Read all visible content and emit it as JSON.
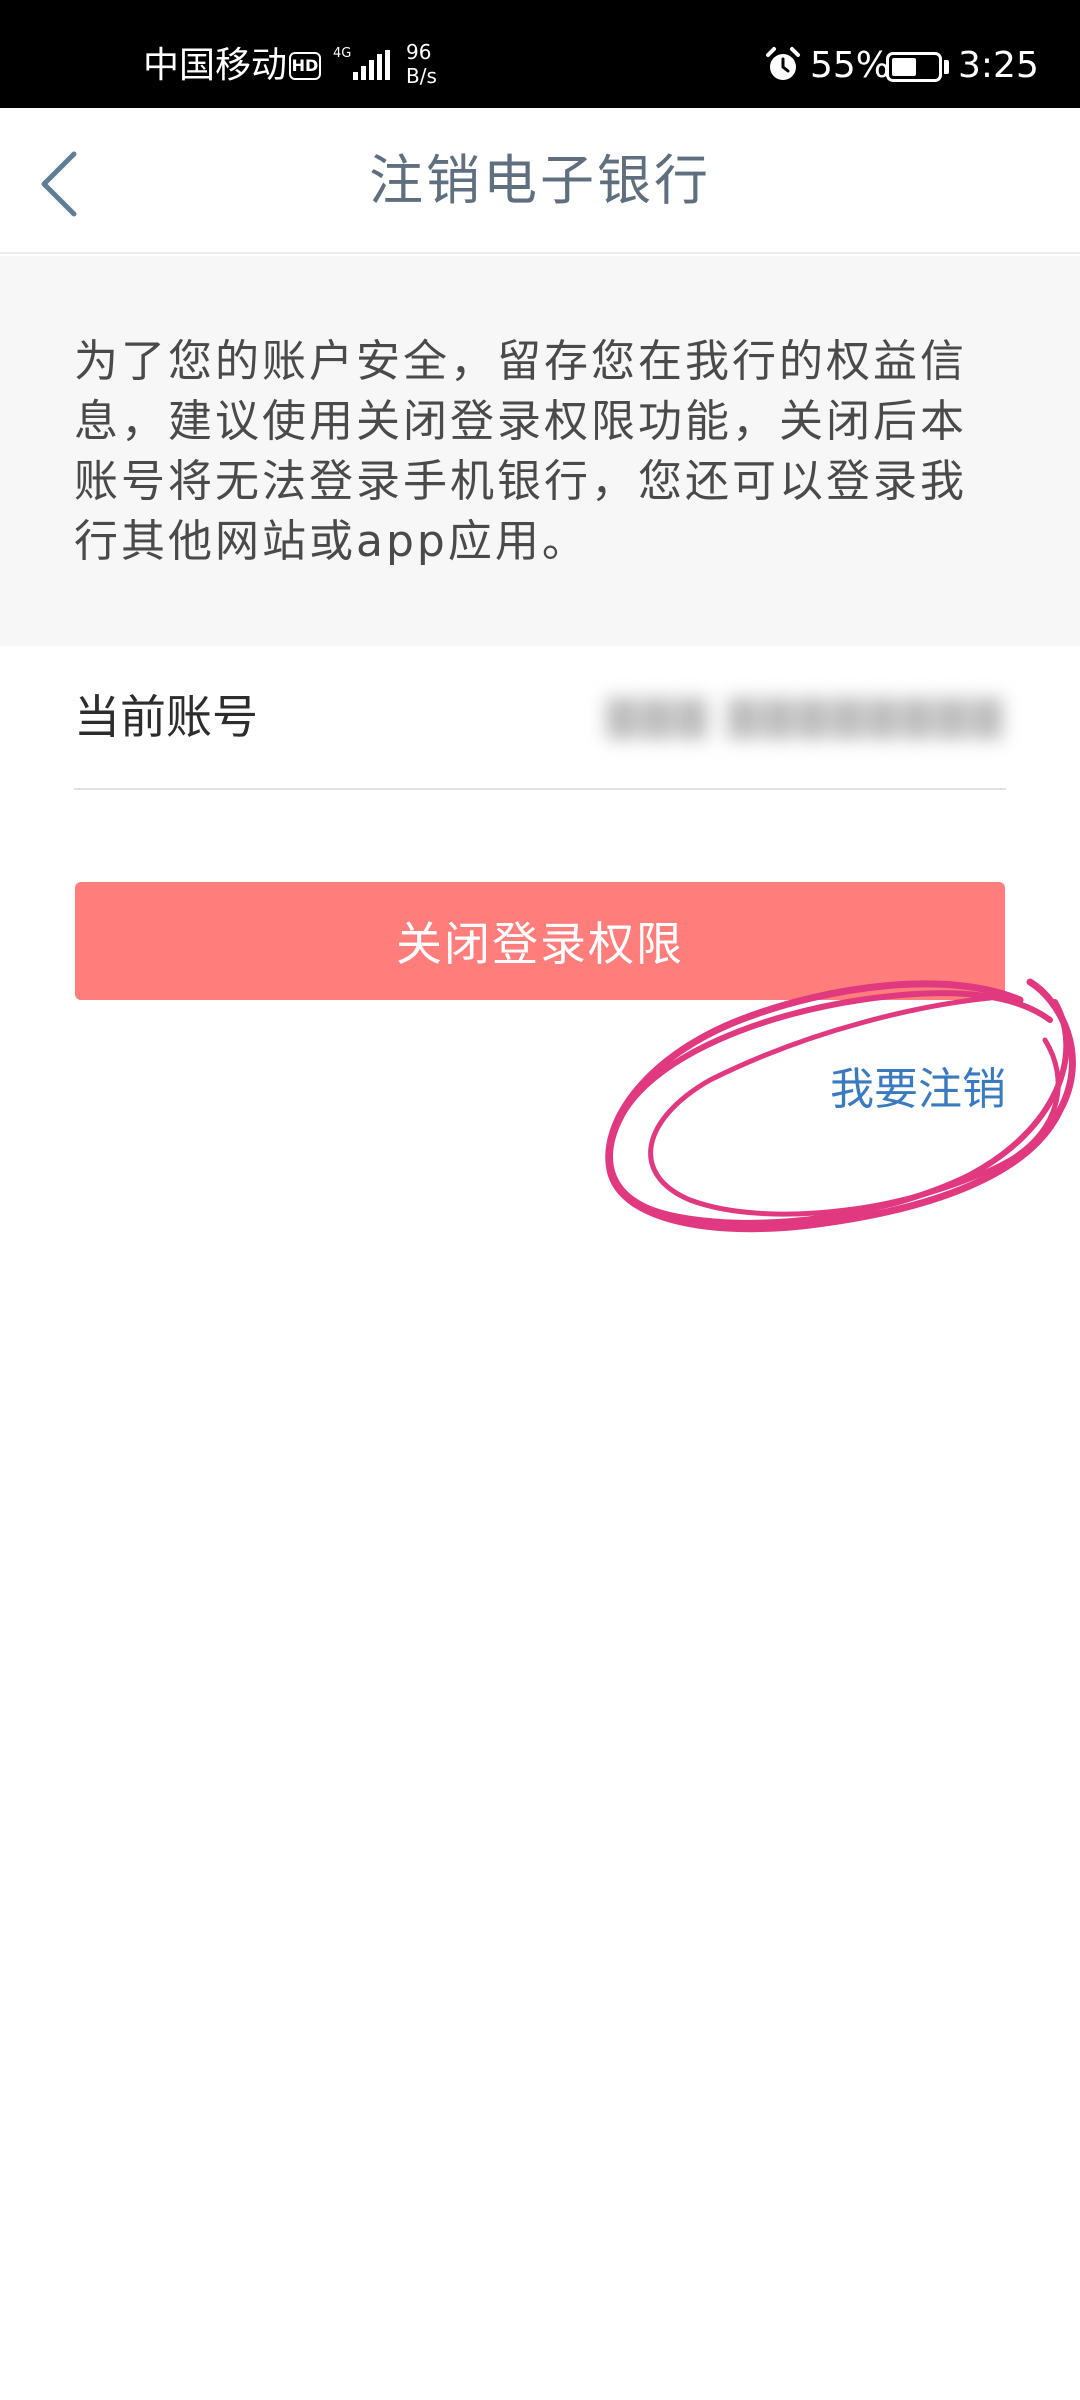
{
  "status_bar": {
    "carrier": "中国移动",
    "hd_badge": "HD",
    "network_type": "4G",
    "net_speed_value": "96",
    "net_speed_unit": "B/s",
    "battery_percent_text": "55%",
    "battery_level": 0.55,
    "time": "3:25",
    "alarm_icon": "alarm-clock-icon",
    "battery_icon": "battery-icon",
    "signal_icon": "cellular-signal-icon"
  },
  "header": {
    "title": "注销电子银行",
    "back_icon": "chevron-left-icon"
  },
  "notice": {
    "text": "为了您的账户安全，留存您在我行的权益信息，建议使用关闭登录权限功能，关闭后本账号将无法登录手机银行，您还可以登录我行其他网站或app应用。"
  },
  "account": {
    "label": "当前账号"
  },
  "actions": {
    "close_login_label": "关闭登录权限",
    "cancel_label": "我要注销"
  },
  "colors": {
    "status_bar_bg": "#000000",
    "title_color": "#5f6f7f",
    "notice_bg": "#f7f7f7",
    "primary_button": "#ff7d7b",
    "link": "#3a7bbf",
    "annotation": "#e0397f"
  }
}
